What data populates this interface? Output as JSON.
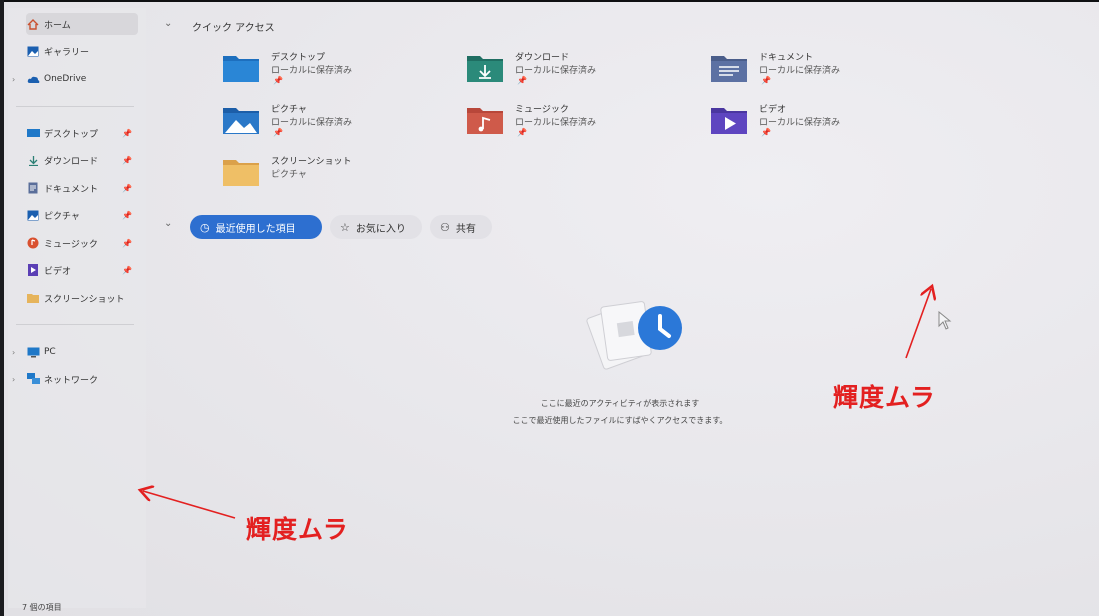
{
  "sidebar": {
    "home": "ホーム",
    "gallery": "ギャラリー",
    "onedrive": "OneDrive",
    "pinned": [
      {
        "label": "デスクトップ",
        "icon": "desktop-icon"
      },
      {
        "label": "ダウンロード",
        "icon": "download-icon"
      },
      {
        "label": "ドキュメント",
        "icon": "document-icon"
      },
      {
        "label": "ピクチャ",
        "icon": "pictures-icon"
      },
      {
        "label": "ミュージック",
        "icon": "music-icon"
      },
      {
        "label": "ビデオ",
        "icon": "video-icon"
      },
      {
        "label": "スクリーンショット",
        "icon": "folder-icon"
      }
    ],
    "pc": "PC",
    "network": "ネットワーク"
  },
  "quick_access": {
    "title": "クイック アクセス",
    "items": [
      {
        "name": "デスクトップ",
        "sub": "ローカルに保存済み",
        "icon": "desktop-folder-icon"
      },
      {
        "name": "ダウンロード",
        "sub": "ローカルに保存済み",
        "icon": "download-folder-icon"
      },
      {
        "name": "ドキュメント",
        "sub": "ローカルに保存済み",
        "icon": "document-folder-icon"
      },
      {
        "name": "ピクチャ",
        "sub": "ローカルに保存済み",
        "icon": "pictures-folder-icon"
      },
      {
        "name": "ミュージック",
        "sub": "ローカルに保存済み",
        "icon": "music-folder-icon"
      },
      {
        "name": "ビデオ",
        "sub": "ローカルに保存済み",
        "icon": "video-folder-icon"
      },
      {
        "name": "スクリーンショット",
        "sub": "ピクチャ",
        "icon": "folder-icon"
      }
    ]
  },
  "tabs": {
    "recent": "最近使用した項目",
    "favorites": "お気に入り",
    "shared": "共有"
  },
  "empty": {
    "line1": "ここに最近のアクティビティが表示されます",
    "line2": "ここで最近使用したファイルにすばやくアクセスできます。"
  },
  "status": "7 個の項目",
  "annotations": [
    "輝度ムラ",
    "輝度ムラ"
  ],
  "colors": {
    "accent": "#2d6fd0",
    "annotation": "#e32020"
  }
}
